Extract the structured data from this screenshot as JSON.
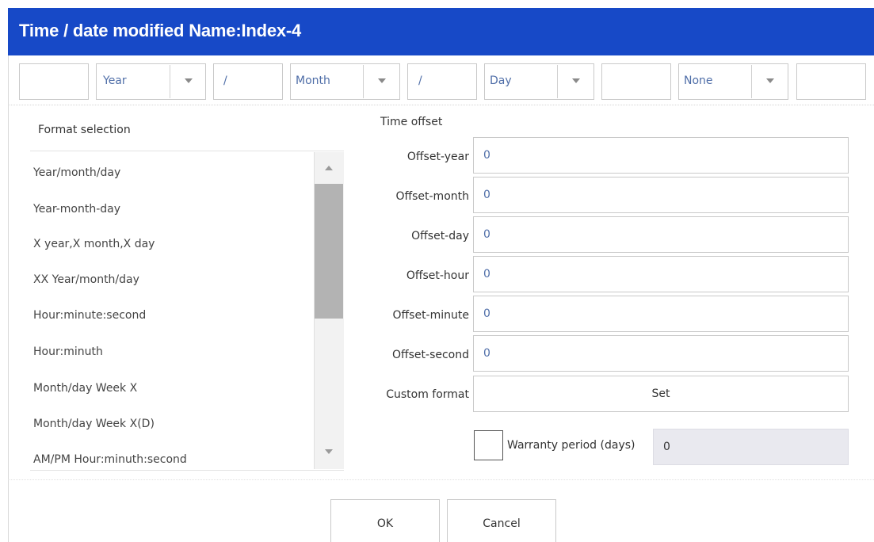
{
  "window": {
    "title": "Time / date modified Name:Index-4"
  },
  "format_bar": {
    "prefix_value": "",
    "year_select": "Year",
    "separator_1": "/",
    "month_select": "Month",
    "separator_2": "/",
    "day_select": "Day",
    "separator_3": "",
    "extra_select": "None",
    "suffix_value": ""
  },
  "format_selection": {
    "label": "Format selection",
    "items": [
      "Year/month/day",
      "Year-month-day",
      "X year,X month,X day",
      "XX Year/month/day",
      "Hour:minute:second",
      "Hour:minuth",
      "Month/day Week X",
      "Month/day Week X(D)",
      "AM/PM Hour:minuth:second"
    ]
  },
  "time_offset": {
    "label": "Time offset",
    "fields": [
      {
        "label": "Offset-year",
        "value": "0"
      },
      {
        "label": "Offset-month",
        "value": "0"
      },
      {
        "label": "Offset-day",
        "value": "0"
      },
      {
        "label": "Offset-hour",
        "value": "0"
      },
      {
        "label": "Offset-minute",
        "value": "0"
      },
      {
        "label": "Offset-second",
        "value": "0"
      }
    ],
    "custom_format_label": "Custom format",
    "set_label": "Set"
  },
  "warranty": {
    "checked": false,
    "label": "Warranty period (days)",
    "value": "0"
  },
  "actions": {
    "ok_label": "OK",
    "cancel_label": "Cancel"
  },
  "colors": {
    "titlebar": "#1749c7",
    "field_text": "#4f6ea8"
  }
}
